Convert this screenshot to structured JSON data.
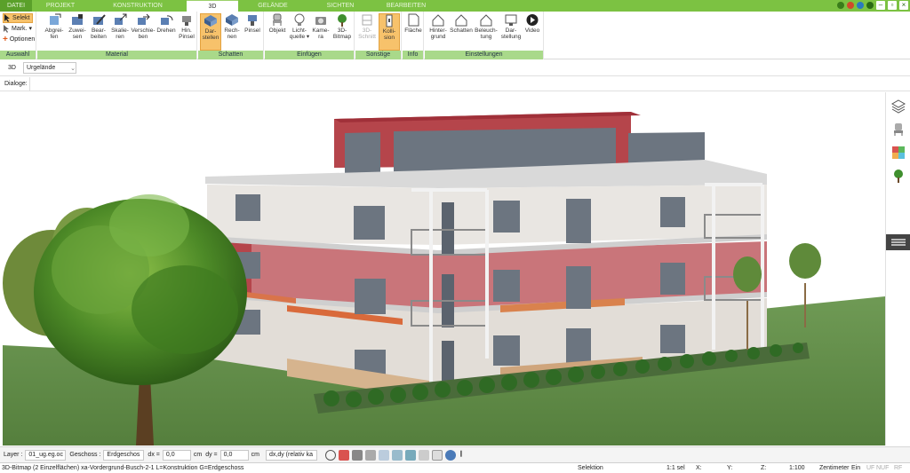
{
  "tabs": [
    {
      "label": "DATEI"
    },
    {
      "label": "PROJEKT"
    },
    {
      "label": "KONSTRUKTION"
    },
    {
      "label": "3D"
    },
    {
      "label": "GELÄNDE"
    },
    {
      "label": "SICHTEN"
    },
    {
      "label": "BEARBEITEN"
    }
  ],
  "ribbon": {
    "auswahl": {
      "label": "Auswahl",
      "selekt": "Selekt",
      "mark": "Mark.",
      "optionen": "Optionen"
    },
    "material": {
      "label": "Material",
      "buttons": [
        {
          "l1": "Abgrei-",
          "l2": "fen"
        },
        {
          "l1": "Zuwei-",
          "l2": "sen"
        },
        {
          "l1": "Bear-",
          "l2": "beiten"
        },
        {
          "l1": "Skalie-",
          "l2": "ren"
        },
        {
          "l1": "Verschie-",
          "l2": "ben"
        },
        {
          "l1": "Drehen",
          "l2": ""
        },
        {
          "l1": "Hin.",
          "l2": "Pinsel"
        }
      ]
    },
    "schatten": {
      "label": "Schatten",
      "buttons": [
        {
          "l1": "Dar-",
          "l2": "stellen"
        },
        {
          "l1": "Rech-",
          "l2": "nen"
        },
        {
          "l1": "Pinsel",
          "l2": ""
        }
      ]
    },
    "einfuegen": {
      "label": "Einfügen",
      "buttons": [
        {
          "l1": "Objekt",
          "l2": ""
        },
        {
          "l1": "Licht-",
          "l2": "quelle ▾"
        },
        {
          "l1": "Kame-",
          "l2": "ra"
        },
        {
          "l1": "3D-",
          "l2": "Bitmap"
        }
      ]
    },
    "sonstige": {
      "label": "Sonstige",
      "buttons": [
        {
          "l1": "3D-",
          "l2": "Schnitt"
        },
        {
          "l1": "Kolli-",
          "l2": "sion"
        }
      ]
    },
    "info": {
      "label": "Info",
      "buttons": [
        {
          "l1": "Fläche",
          "l2": ""
        }
      ]
    },
    "einstellungen": {
      "label": "Einstellungen",
      "buttons": [
        {
          "l1": "Hinter-",
          "l2": "grund"
        },
        {
          "l1": "Schatten",
          "l2": ""
        },
        {
          "l1": "Beleuch-",
          "l2": "tung"
        },
        {
          "l1": "Dar-",
          "l2": "stellung"
        },
        {
          "l1": "Video",
          "l2": ""
        }
      ]
    }
  },
  "view": {
    "mode": "3D",
    "selected": "Urgelände"
  },
  "dialoge": {
    "label": "Dialoge:"
  },
  "bottom_toolbar": {
    "layer_label": "Layer :",
    "layer_value": "01_ug.eg.oc",
    "geschoss_label": "Geschoss :",
    "geschoss_value": "Erdgeschos",
    "dx_label": "dx =",
    "dx_value": "0,0",
    "dx_unit": "cm",
    "dy_label": "dy =",
    "dy_value": "0,0",
    "dy_unit": "cm",
    "mode_value": "dx,dy (relativ ka"
  },
  "status": {
    "left": "3D-Bitmap (2 Einzelflächen) xa-Vordergrund-Busch-2-1 L=Konstruktion G=Erdgeschoss",
    "selektion": "Selektion",
    "sel": "1:1 sel",
    "x": "X:",
    "y": "Y:",
    "z": "Z:",
    "scale": "1:100",
    "unit": "Zentimeter",
    "ein": "Ein",
    "uf": "UF",
    "nuf": "NUF",
    "rf": "RF"
  },
  "colors": {
    "accent": "#7cc242",
    "ribbon_group": "#a9d98a",
    "selected": "#f7c26b",
    "facade_red": "#b5454b"
  }
}
